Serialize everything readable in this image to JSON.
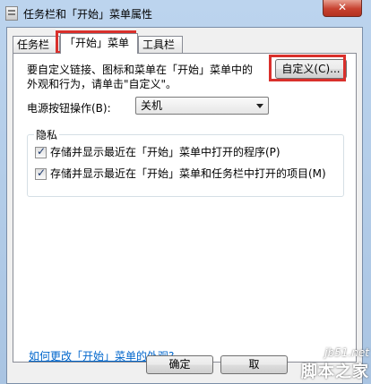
{
  "window": {
    "title": "任务栏和「开始」菜单属性",
    "close_label": "✕"
  },
  "tabs": [
    {
      "label": "任务栏"
    },
    {
      "label": "「开始」菜单"
    },
    {
      "label": "工具栏"
    }
  ],
  "start_menu": {
    "description": "要自定义链接、图标和菜单在「开始」菜单中的外观和行为，请单击\"自定义\"。",
    "customize_button": "自定义(C)...",
    "power_label": "电源按钮操作(B):",
    "power_value": "关机",
    "privacy": {
      "title": "隐私",
      "options": [
        {
          "label": "存储并显示最近在「开始」菜单中打开的程序(P)",
          "checked": true
        },
        {
          "label": "存储并显示最近在「开始」菜单和任务栏中打开的项目(M)",
          "checked": true
        }
      ]
    },
    "help_link": "如何更改「开始」菜单的外观?"
  },
  "buttons": {
    "ok": "确定",
    "cancel": "取"
  },
  "watermark": {
    "url": "jb51.net",
    "name": "脚本之家"
  },
  "colors": {
    "highlight": "#d9302c",
    "link": "#0066cc"
  }
}
